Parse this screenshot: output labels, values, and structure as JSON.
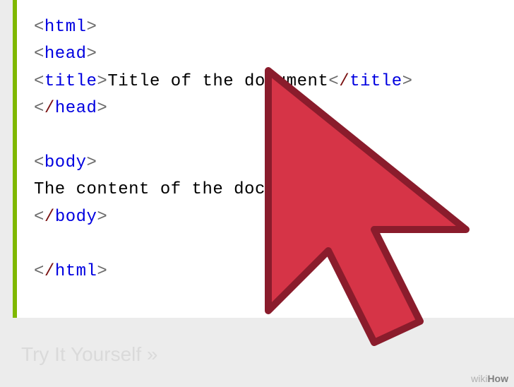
{
  "code": {
    "tags": {
      "html_open": "html",
      "head_open": "head",
      "title_open": "title",
      "title_close": "title",
      "head_close": "head",
      "body_open": "body",
      "body_close": "body",
      "html_close": "html"
    },
    "title_text": "Title of the document",
    "body_text_partial": "The content of the docu",
    "angle_open": "<",
    "angle_close": ">",
    "slash": "/"
  },
  "faded_caption": "Try It Yourself »",
  "watermark": {
    "wiki": "wiki",
    "how": "How"
  }
}
